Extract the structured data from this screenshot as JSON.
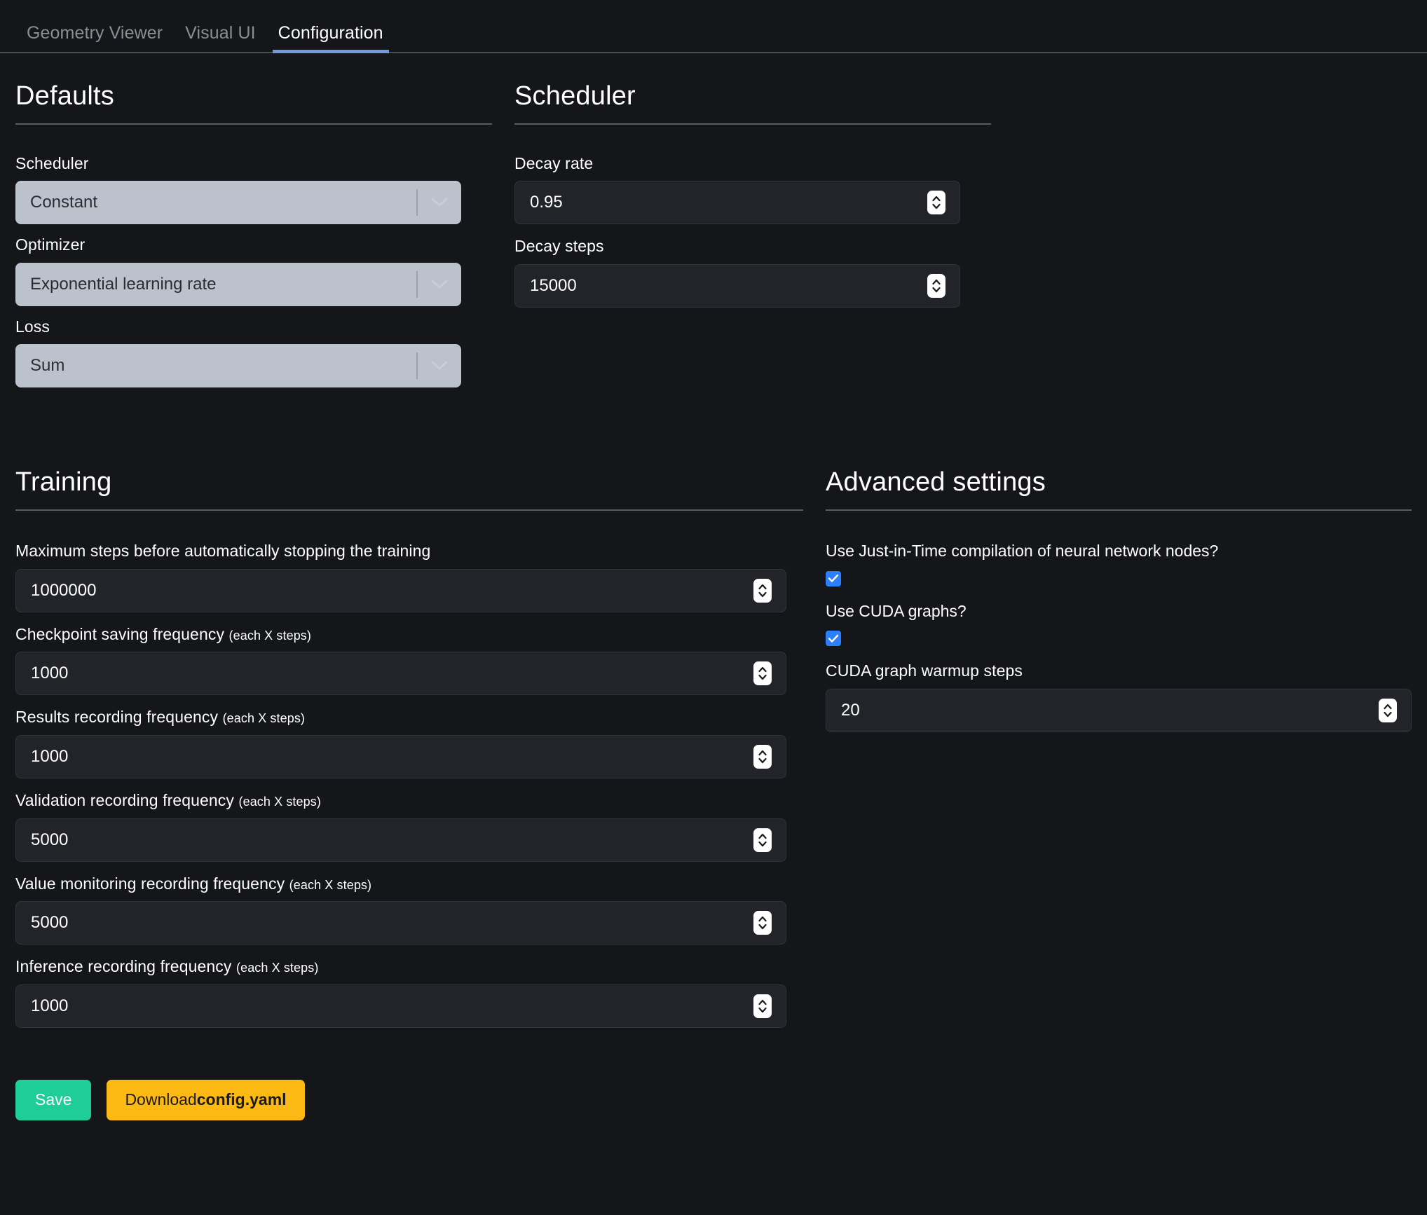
{
  "tabs": [
    {
      "label": "Geometry Viewer",
      "active": false
    },
    {
      "label": "Visual UI",
      "active": false
    },
    {
      "label": "Configuration",
      "active": true
    }
  ],
  "defaults": {
    "title": "Defaults",
    "fields": [
      {
        "label": "Scheduler",
        "value": "Constant"
      },
      {
        "label": "Optimizer",
        "value": "Exponential learning rate"
      },
      {
        "label": "Loss",
        "value": "Sum"
      }
    ]
  },
  "scheduler": {
    "title": "Scheduler",
    "fields": [
      {
        "label": "Decay rate",
        "value": "0.95"
      },
      {
        "label": "Decay steps",
        "value": "15000"
      }
    ]
  },
  "training": {
    "title": "Training",
    "fields": [
      {
        "label": "Maximum steps before automatically stopping the training",
        "hint": "",
        "value": "1000000"
      },
      {
        "label": "Checkpoint saving frequency",
        "hint": "(each X steps)",
        "value": "1000"
      },
      {
        "label": "Results recording frequency",
        "hint": "(each X steps)",
        "value": "1000"
      },
      {
        "label": "Validation recording frequency",
        "hint": "(each X steps)",
        "value": "5000"
      },
      {
        "label": "Value monitoring recording frequency",
        "hint": "(each X steps)",
        "value": "5000"
      },
      {
        "label": "Inference recording frequency",
        "hint": "(each X steps)",
        "value": "1000"
      }
    ]
  },
  "advanced": {
    "title": "Advanced settings",
    "jit_label": "Use Just-in-Time compilation of neural network nodes?",
    "jit_checked": true,
    "cuda_label": "Use CUDA graphs?",
    "cuda_checked": true,
    "warmup_label": "CUDA graph warmup steps",
    "warmup_value": "20"
  },
  "actions": {
    "save_label": "Save",
    "download_prefix": "Download ",
    "download_file": "config.yaml"
  },
  "colors": {
    "accent_green": "#1fcd99",
    "accent_amber": "#fcb813",
    "tab_underline": "#7099e0",
    "checkbox_blue": "#2b7fff",
    "select_bg": "#bcc2cb",
    "background": "#151619"
  }
}
